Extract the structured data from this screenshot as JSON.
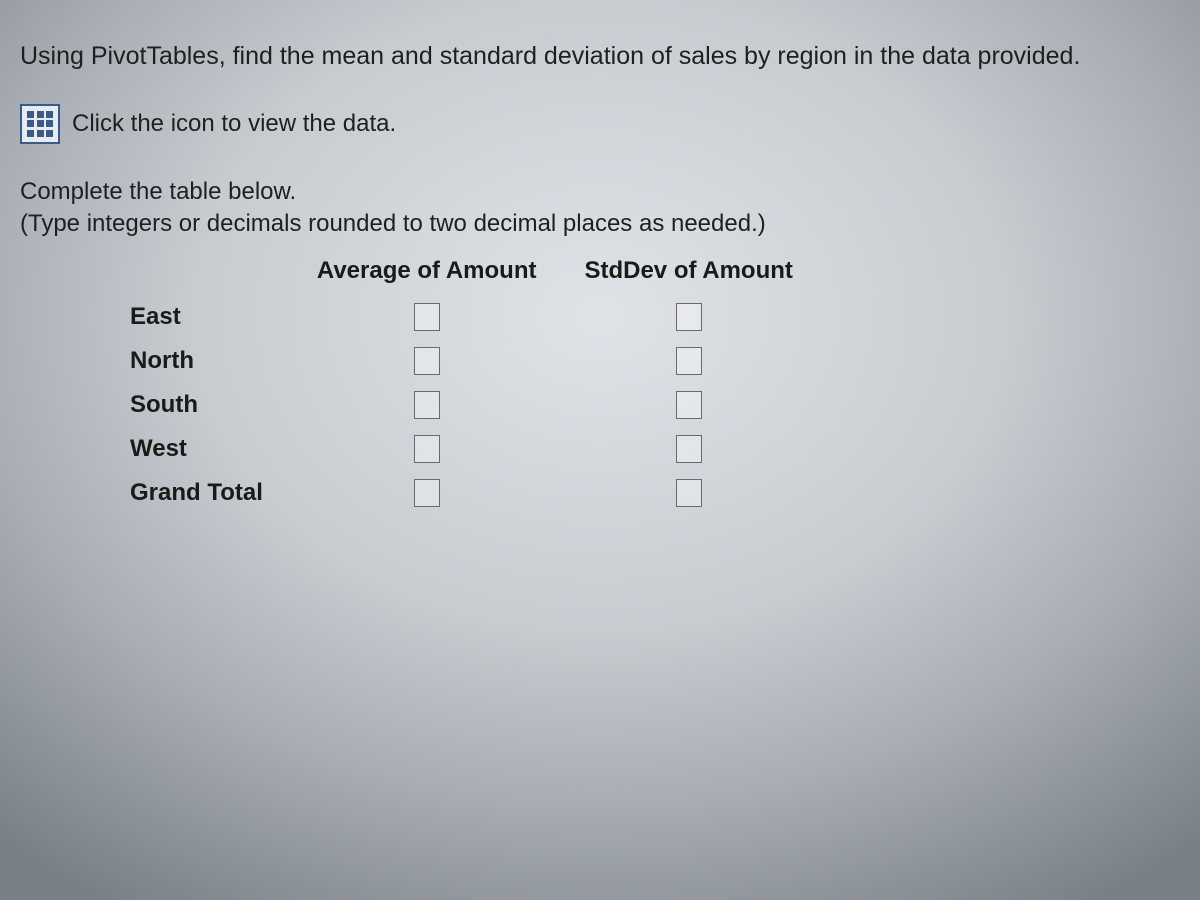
{
  "prompt": "Using PivotTables, find the mean and standard deviation of sales by region in the data provided.",
  "data_link": {
    "text": "Click the icon to view the data."
  },
  "instructions_line1": "Complete the table below.",
  "instructions_line2": "(Type integers or decimals rounded to two decimal places as needed.)",
  "table": {
    "headers": {
      "avg": "Average of Amount",
      "std": "StdDev of Amount"
    },
    "rows": [
      {
        "label": "East"
      },
      {
        "label": "North"
      },
      {
        "label": "South"
      },
      {
        "label": "West"
      },
      {
        "label": "Grand Total"
      }
    ]
  }
}
